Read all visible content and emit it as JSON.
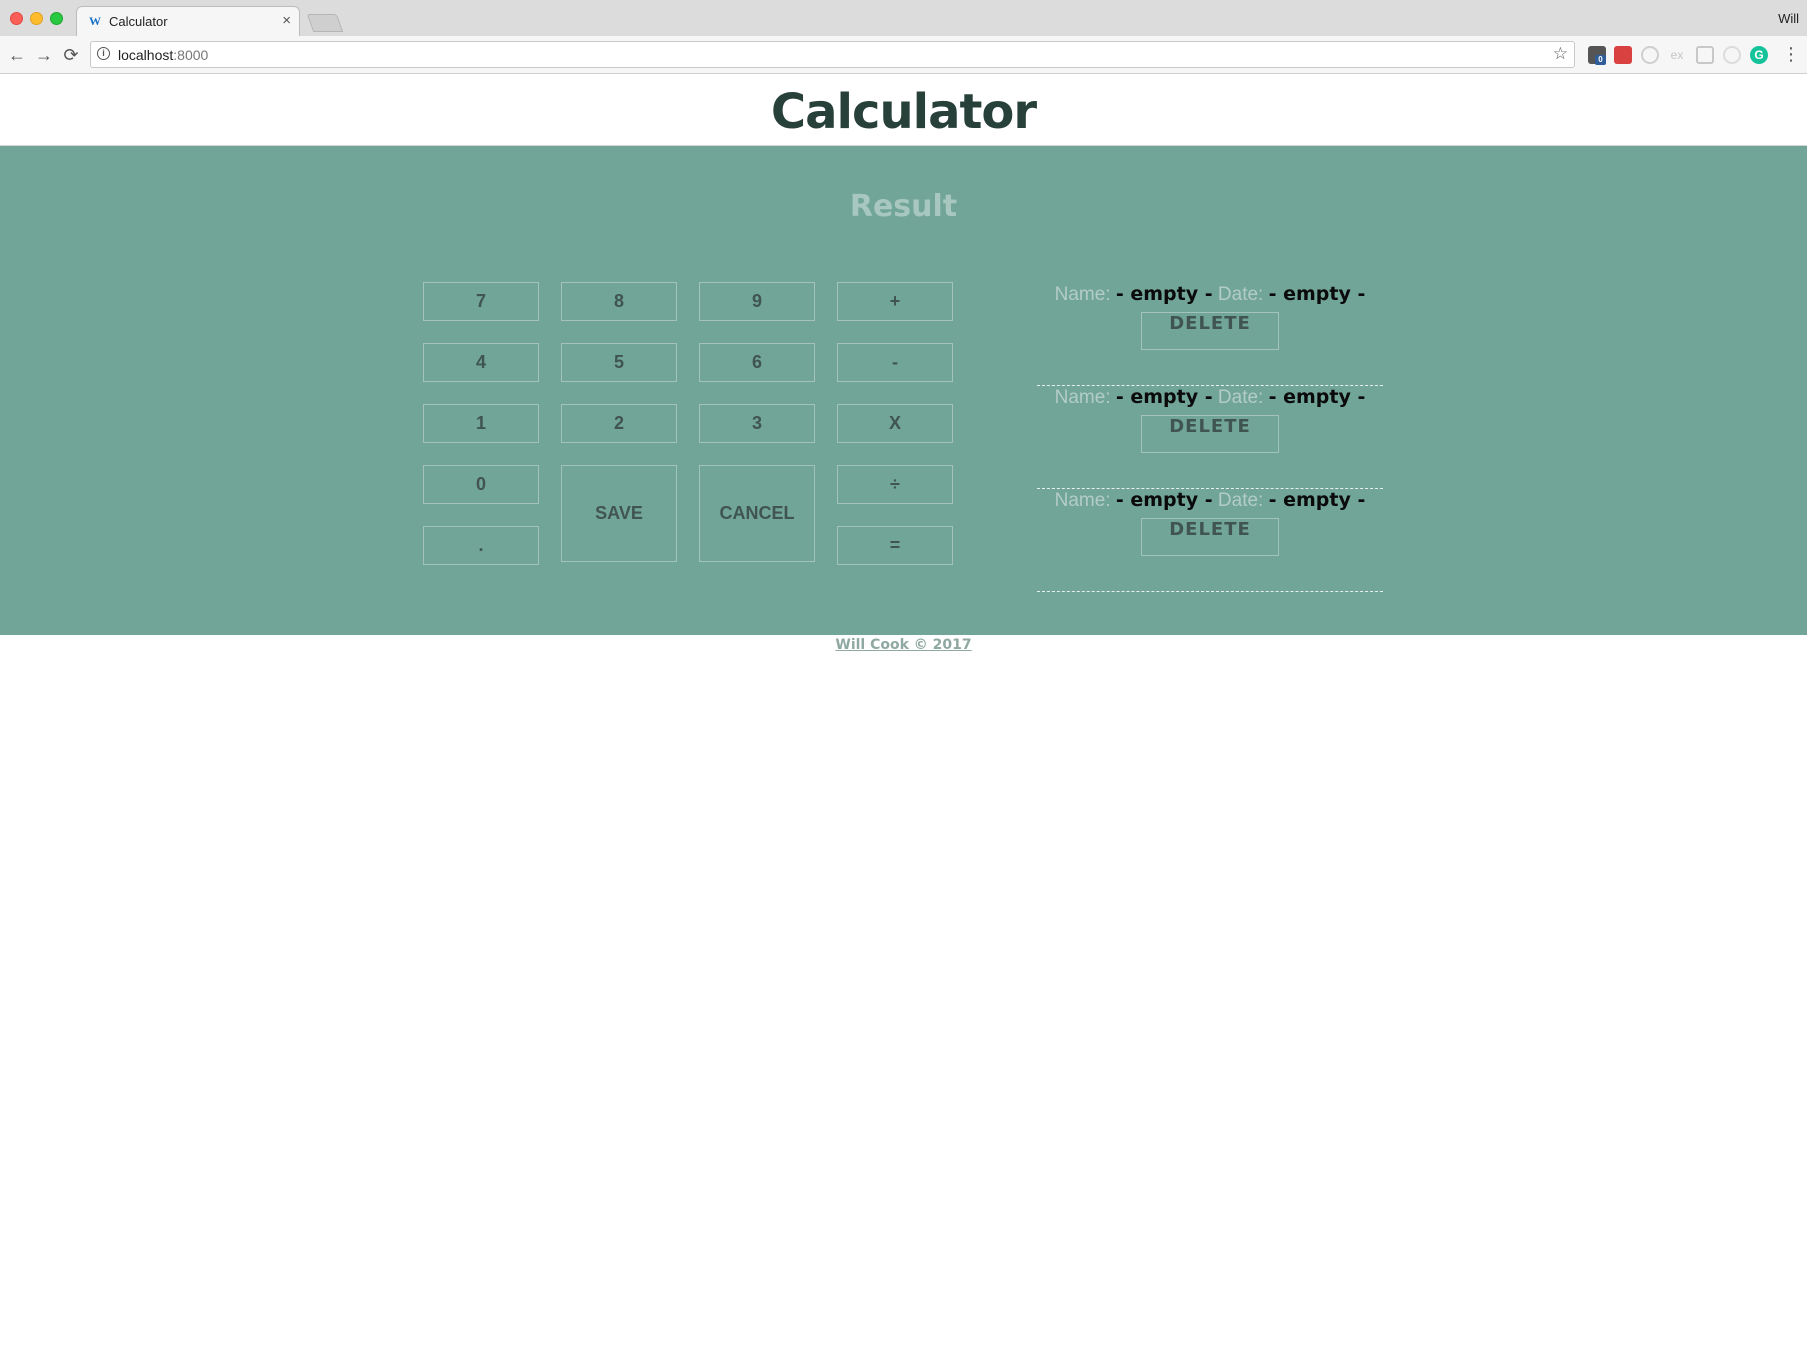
{
  "browser": {
    "tab": {
      "favicon": "W",
      "title": "Calculator",
      "close": "×"
    },
    "profile_name": "Will",
    "url": {
      "host": "localhost",
      "port": ":8000"
    },
    "nav": {
      "back": "←",
      "forward": "→",
      "reload": "⟳"
    },
    "omnibox": {
      "info": "i",
      "star": "☆"
    },
    "menu": "⋮",
    "extensions": [
      {
        "name": "extension-badge",
        "badge": "0"
      },
      {
        "name": "extension-red"
      },
      {
        "name": "extension-circle"
      },
      {
        "name": "extension-ex",
        "label": "ex"
      },
      {
        "name": "extension-square"
      },
      {
        "name": "extension-circle-light"
      },
      {
        "name": "grammarly",
        "label": "G"
      }
    ]
  },
  "page": {
    "title": "Calculator",
    "result": "Result"
  },
  "keypad": {
    "k7": "7",
    "k8": "8",
    "k9": "9",
    "plus": "+",
    "k4": "4",
    "k5": "5",
    "k6": "6",
    "minus": "-",
    "k1": "1",
    "k2": "2",
    "k3": "3",
    "times": "X",
    "k0": "0",
    "dot": ".",
    "save": "SAVE",
    "cancel": "CANCEL",
    "divide": "÷",
    "equals": "="
  },
  "saved": {
    "name_label": "Name:",
    "date_label": "Date:",
    "items": [
      {
        "name": "- empty -",
        "date": "- empty -",
        "delete": "DELETE"
      },
      {
        "name": "- empty -",
        "date": "- empty -",
        "delete": "DELETE"
      },
      {
        "name": "- empty -",
        "date": "- empty -",
        "delete": "DELETE"
      }
    ]
  },
  "footer": {
    "text": "Will Cook © 2017"
  }
}
